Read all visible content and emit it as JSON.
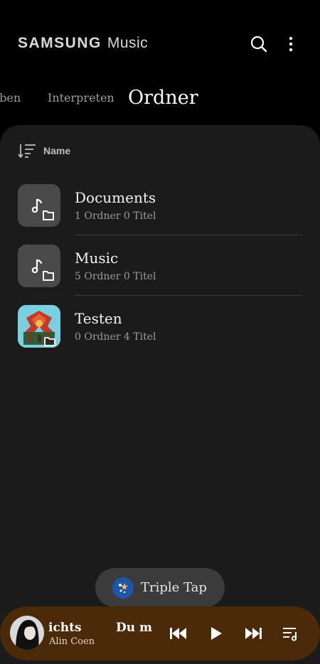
{
  "header": {
    "brand": "SAMSUNG",
    "app_name": "Music"
  },
  "tabs": [
    {
      "label": "lben",
      "active": false
    },
    {
      "label": "Interpreten",
      "active": false
    },
    {
      "label": "Ordner",
      "active": true
    }
  ],
  "sort": {
    "label": "Name",
    "icon": "sort-icon"
  },
  "folders": [
    {
      "title": "Documents",
      "subtitle": "1 Ordner 0 Titel",
      "icon": "music-folder-icon"
    },
    {
      "title": "Music",
      "subtitle": "5 Ordner 0 Titel",
      "icon": "music-folder-icon"
    },
    {
      "title": "Testen",
      "subtitle": "0 Ordner 4 Titel",
      "icon": "album-art-thumbnail"
    }
  ],
  "toast": {
    "label": "Triple Tap",
    "icon": "accessibility-icon"
  },
  "mini_player": {
    "title": "ichts",
    "next_title": "Du m",
    "artist": "Alin Coen",
    "controls": [
      "previous-icon",
      "play-icon",
      "next-icon",
      "queue-icon"
    ]
  },
  "colors": {
    "background": "#000000",
    "panel": "#1b1b1b",
    "player": "#4a2a08",
    "folder_tile": "#4a4a4a"
  }
}
